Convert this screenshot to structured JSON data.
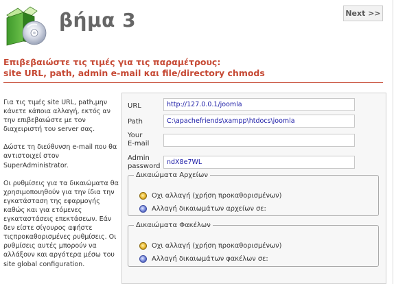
{
  "header": {
    "step_title": "βήμα 3",
    "next_label": "Next >>"
  },
  "section": {
    "heading_line1": "Επιβεβαιώστε τις τιμές για τις παραμέτρους:",
    "heading_line2": "site URL, path, admin e-mail και file/directory chmods"
  },
  "help": {
    "p1": "Για τις τιμές site URL, path,μην κάνετε κάποια αλλαγή, εκτός αν την επιβεβαιώστε με τον διαχειριστή του server σας.",
    "p2": "Δώστε τη διεύθυνση e-mail που θα αντιστοιχεί στον SuperAdministrator.",
    "p3": "Οι ρυθμίσεις για τα δικαιώματα θα χρησιμοποιηθούν για την ίδια την εγκατάσταση της εφαρμογής καθώς και για ετόμενες εγκαταστάσεις επεκτάσεων. Εάν δεν είστε σίγουρος αφήστε τιςπροκαθορισμένες ρυθμίσεις. Οι ρυθμίσεις αυτές μπορούν να αλλάξουν και αργότερα μέσω του site global configuration."
  },
  "form": {
    "url_label": "URL",
    "url_value": "http://127.0.0.1/joomla",
    "path_label": "Path",
    "path_value": "C:\\apachefriends\\xampp\\htdocs\\joomla",
    "email_label_1": "Your",
    "email_label_2": "E-mail",
    "email_value": "",
    "password_label_1": "Admin",
    "password_label_2": "password",
    "password_value": "ndX8e7WL"
  },
  "file_perms": {
    "legend": "Δικαιώματα Αρχείων",
    "option_default": "Οχι αλλαγή (χρήση προκαθορισμένων)",
    "option_custom": "Αλλαγή δικαιωμάτων αρχείων σε:",
    "selected": "default"
  },
  "dir_perms": {
    "legend": "Δικαιώματα Φακέλων",
    "option_default": "Οχι αλλαγή (χρήση προκαθορισμένων)",
    "option_custom": "Αλλαγή δικαιωμάτων φακέλων σε:",
    "selected": "default"
  },
  "colors": {
    "heading": "#c64934",
    "input_text": "#1a1aa6",
    "title": "#666666"
  }
}
